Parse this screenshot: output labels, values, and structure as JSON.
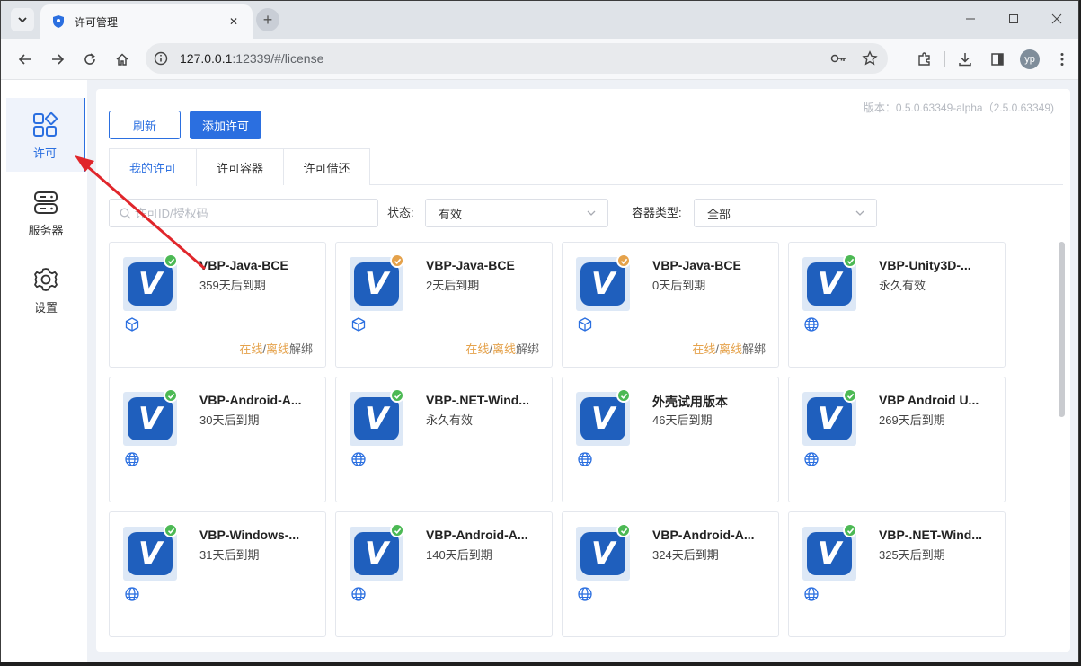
{
  "browser": {
    "tab_title": "许可管理",
    "url_host": "127.0.0.1",
    "url_rest": ":12339/#/license",
    "avatar_initials": "yp"
  },
  "sidebar": {
    "items": [
      {
        "label": "许可",
        "icon": "apps-icon",
        "active": true
      },
      {
        "label": "服务器",
        "icon": "server-icon",
        "active": false
      },
      {
        "label": "设置",
        "icon": "gear-icon",
        "active": false
      }
    ]
  },
  "header": {
    "version": "版本：0.5.0.63349-alpha（2.5.0.63349)",
    "refresh_label": "刷新",
    "add_label": "添加许可"
  },
  "tabs": [
    "我的许可",
    "许可容器",
    "许可借还"
  ],
  "filters": {
    "search_placeholder": "许可ID/授权码",
    "status_label": "状态:",
    "status_value": "有效",
    "container_label": "容器类型:",
    "container_value": "全部"
  },
  "colors": {
    "accent": "#2b6fe0",
    "status_ok": "#4cb954",
    "status_warn": "#e5a24b"
  },
  "cards": [
    {
      "name": "VBP-Java-BCE",
      "expiry": "359天后到期",
      "status": "ok",
      "type_icon": "cube-icon",
      "actions": {
        "online": "在线",
        "sep": "/",
        "offline": "离线",
        "unbind": "解绑"
      }
    },
    {
      "name": "VBP-Java-BCE",
      "expiry": "2天后到期",
      "status": "warn",
      "type_icon": "cube-icon",
      "actions": {
        "online": "在线",
        "sep": "/",
        "offline": "离线",
        "unbind": "解绑"
      }
    },
    {
      "name": "VBP-Java-BCE",
      "expiry": "0天后到期",
      "status": "warn",
      "type_icon": "cube-icon",
      "actions": {
        "online": "在线",
        "sep": "/",
        "offline": "离线",
        "unbind": "解绑"
      }
    },
    {
      "name": "VBP-Unity3D-...",
      "expiry": "永久有效",
      "status": "ok",
      "type_icon": "globe-icon"
    },
    {
      "name": "VBP-Android-A...",
      "expiry": "30天后到期",
      "status": "ok",
      "type_icon": "globe-icon"
    },
    {
      "name": "VBP-.NET-Wind...",
      "expiry": "永久有效",
      "status": "ok",
      "type_icon": "globe-icon"
    },
    {
      "name": "外壳试用版本",
      "expiry": "46天后到期",
      "status": "ok",
      "type_icon": "globe-icon"
    },
    {
      "name": "VBP Android U...",
      "expiry": "269天后到期",
      "status": "ok",
      "type_icon": "globe-icon"
    },
    {
      "name": "VBP-Windows-...",
      "expiry": "31天后到期",
      "status": "ok",
      "type_icon": "globe-icon"
    },
    {
      "name": "VBP-Android-A...",
      "expiry": "140天后到期",
      "status": "ok",
      "type_icon": "globe-icon"
    },
    {
      "name": "VBP-Android-A...",
      "expiry": "324天后到期",
      "status": "ok",
      "type_icon": "globe-icon"
    },
    {
      "name": "VBP-.NET-Wind...",
      "expiry": "325天后到期",
      "status": "ok",
      "type_icon": "globe-icon"
    }
  ]
}
